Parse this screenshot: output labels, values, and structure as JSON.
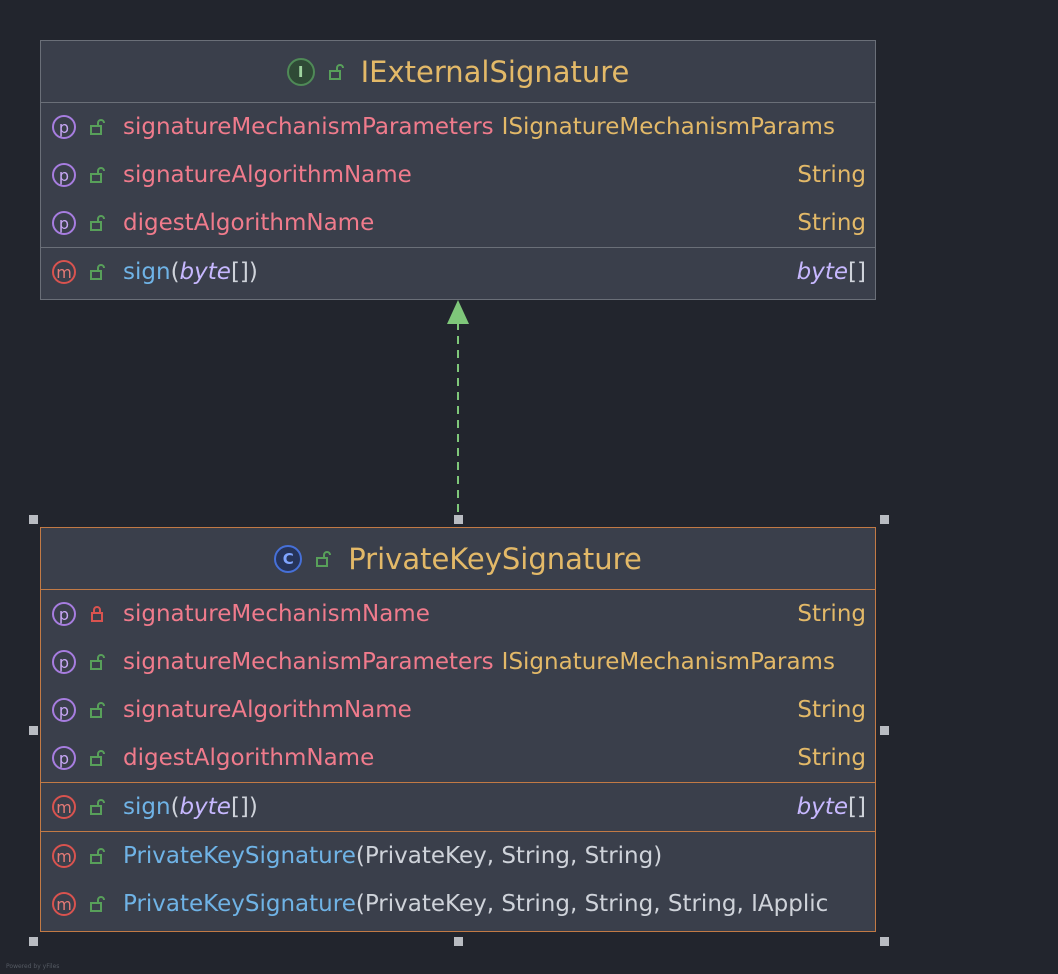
{
  "colors": {
    "background": "#22252d",
    "box_fill": "#3a3f4b",
    "box_border": "#6a6f78",
    "selected_border": "#c27a45",
    "title": "#e3b968",
    "field": "#f07b8c",
    "method": "#6fb3e6",
    "type": "#e3b968",
    "arrow": "#7fc77a"
  },
  "interface_box": {
    "kind_icon": "interface-icon",
    "kind_letter": "I",
    "title": "IExternalSignature",
    "fields": [
      {
        "name": "signatureMechanismParameters",
        "type": "ISignatureMechanismParams",
        "visibility": "public"
      },
      {
        "name": "signatureAlgorithmName",
        "type": "String",
        "visibility": "public"
      },
      {
        "name": "digestAlgorithmName",
        "type": "String",
        "visibility": "public"
      }
    ],
    "methods": [
      {
        "name": "sign",
        "param_open": "(",
        "param_type": "byte",
        "param_close": "[])",
        "return_type": "byte",
        "return_suffix": "[]"
      }
    ]
  },
  "class_box": {
    "kind_icon": "class-icon",
    "kind_letter": "C",
    "title": "PrivateKeySignature",
    "fields": [
      {
        "name": "signatureMechanismName",
        "type": "String",
        "visibility": "private"
      },
      {
        "name": "signatureMechanismParameters",
        "type": "ISignatureMechanismParams",
        "visibility": "public"
      },
      {
        "name": "signatureAlgorithmName",
        "type": "String",
        "visibility": "public"
      },
      {
        "name": "digestAlgorithmName",
        "type": "String",
        "visibility": "public"
      }
    ],
    "methods": [
      {
        "name": "sign",
        "param_open": "(",
        "param_type": "byte",
        "param_close": "[])",
        "return_type": "byte",
        "return_suffix": "[]"
      }
    ],
    "constructors": [
      {
        "name": "PrivateKeySignature",
        "params": "(PrivateKey, String, String)"
      },
      {
        "name": "PrivateKeySignature",
        "params": "(PrivateKey, String, String, String, IApplic"
      }
    ]
  },
  "relationship": {
    "type": "implements",
    "from": "PrivateKeySignature",
    "to": "IExternalSignature",
    "style": "dashed"
  },
  "badges": {
    "property": "p",
    "method": "m"
  },
  "watermark": "Powered by yFiles"
}
